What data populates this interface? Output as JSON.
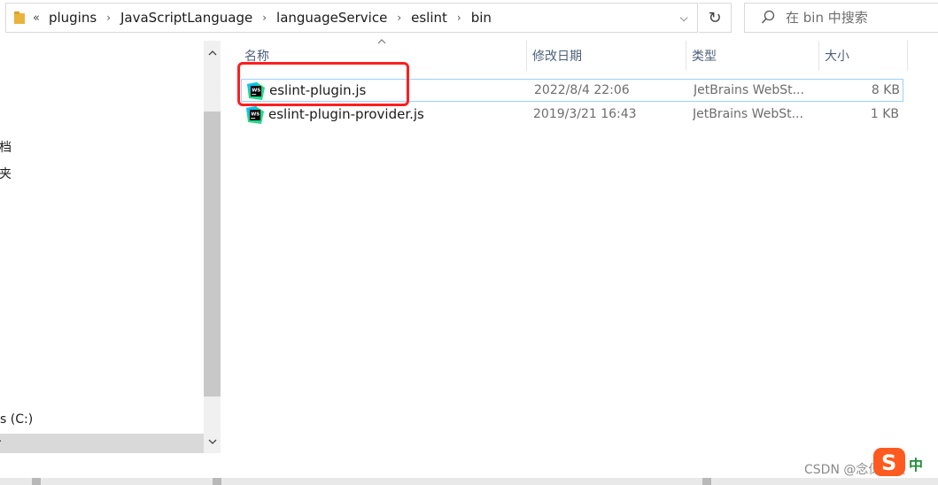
{
  "address_bar": {
    "overflow": "«",
    "crumbs": [
      "plugins",
      "JavaScriptLanguage",
      "languageService",
      "eslint",
      "bin"
    ],
    "separator": "›",
    "dropdown_glyph": "⌵",
    "refresh_glyph": "↻"
  },
  "search": {
    "placeholder": "在 bin 中搜索",
    "icon": "search-icon"
  },
  "nav": {
    "items": [
      {
        "label": "档"
      },
      {
        "label": "夹"
      },
      {
        "label": "s (C:)"
      }
    ],
    "selected_glyph": "·"
  },
  "columns": {
    "name": "名称",
    "date": "修改日期",
    "type": "类型",
    "size": "大小"
  },
  "files": [
    {
      "name": "eslint-plugin.js",
      "date": "2022/8/4 22:06",
      "type": "JetBrains WebSt...",
      "size": "8 KB",
      "icon": "webstorm-file-icon"
    },
    {
      "name": "eslint-plugin-provider.js",
      "date": "2019/3/21 16:43",
      "type": "JetBrains WebSt...",
      "size": "1 KB",
      "icon": "webstorm-file-icon"
    }
  ],
  "watermark": "CSDN @念伢有笑",
  "ime": {
    "label": "中"
  },
  "colors": {
    "highlight": "#ff1e1e",
    "selection_border": "#99d1ff",
    "header_text": "#4c607a"
  }
}
